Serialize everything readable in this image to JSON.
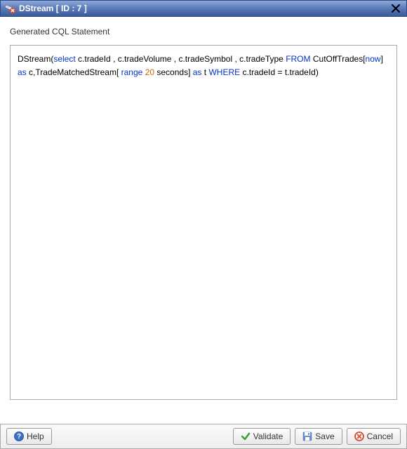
{
  "header": {
    "title": "DStream [ ID : 7 ]",
    "icon": "stream-icon"
  },
  "label": "Generated CQL Statement",
  "cql": {
    "parts": [
      {
        "t": "plain",
        "v": "DStream("
      },
      {
        "t": "kw",
        "v": "select"
      },
      {
        "t": "plain",
        "v": "  c.tradeId , c.tradeVolume , c.tradeSymbol , c.tradeType  "
      },
      {
        "t": "kw",
        "v": "FROM"
      },
      {
        "t": "plain",
        "v": " CutOffTrades["
      },
      {
        "t": "kw",
        "v": "now"
      },
      {
        "t": "plain",
        "v": "] "
      },
      {
        "t": "kw",
        "v": "as"
      },
      {
        "t": "plain",
        "v": " c,TradeMatchedStream[ "
      },
      {
        "t": "kw",
        "v": "range"
      },
      {
        "t": "plain",
        "v": " "
      },
      {
        "t": "num",
        "v": "20"
      },
      {
        "t": "plain",
        "v": " seconds] "
      },
      {
        "t": "kw",
        "v": "as"
      },
      {
        "t": "plain",
        "v": " t "
      },
      {
        "t": "kw",
        "v": "WHERE"
      },
      {
        "t": "plain",
        "v": "  c.tradeId  =  t.tradeId)"
      }
    ]
  },
  "footer": {
    "help": "Help",
    "validate": "Validate",
    "save": "Save",
    "cancel": "Cancel"
  }
}
